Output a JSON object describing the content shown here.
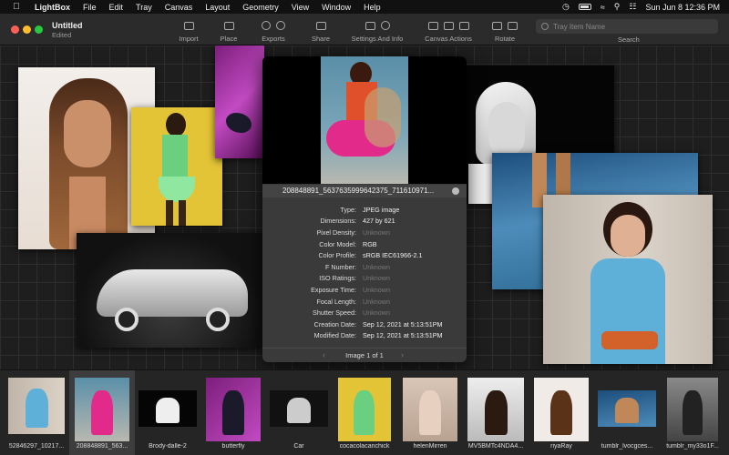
{
  "menubar": {
    "app_name": "LightBox",
    "items": [
      "File",
      "Edit",
      "Tray",
      "Canvas",
      "Layout",
      "Geometry",
      "View",
      "Window",
      "Help"
    ],
    "date_time": "Sun Jun 8  12:36 PM"
  },
  "toolbar": {
    "doc_title": "Untitled",
    "doc_subtitle": "Edited",
    "groups": [
      {
        "label": "Import"
      },
      {
        "label": "Place"
      },
      {
        "label": "Exports"
      },
      {
        "label": "Share"
      },
      {
        "label": "Settings And Info"
      },
      {
        "label": "Canvas Actions"
      },
      {
        "label": "Rotate"
      }
    ],
    "search_placeholder": "Tray Item Name",
    "search_label": "Search"
  },
  "info_popover": {
    "filename": "208848891_5637635999642375_711610971...",
    "rows": [
      {
        "key": "Type:",
        "value": "JPEG image",
        "unknown": false
      },
      {
        "key": "Dimensions:",
        "value": "427 by 621",
        "unknown": false
      },
      {
        "key": "Pixel Density:",
        "value": "Unknown",
        "unknown": true
      },
      {
        "key": "Color Model:",
        "value": "RGB",
        "unknown": false
      },
      {
        "key": "Color Profile:",
        "value": "sRGB IEC61966-2.1",
        "unknown": false
      },
      {
        "key": "F Number:",
        "value": "Unknown",
        "unknown": true
      },
      {
        "key": "ISO Ratings:",
        "value": "Unknown",
        "unknown": true
      },
      {
        "key": "Exposure Time:",
        "value": "Unknown",
        "unknown": true
      },
      {
        "key": "Focal Length:",
        "value": "Unknown",
        "unknown": true
      },
      {
        "key": "Shutter Speed:",
        "value": "Unknown",
        "unknown": true
      },
      {
        "key": "Creation Date:",
        "value": "Sep 12, 2021 at 5:13:51PM",
        "unknown": false
      },
      {
        "key": "Modified Date:",
        "value": "Sep 12, 2021 at 5:13:51PM",
        "unknown": false
      }
    ],
    "nav_label": "Image 1 of 1"
  },
  "tray": {
    "items": [
      {
        "label": "52846297_10217..."
      },
      {
        "label": "208848891_563..."
      },
      {
        "label": "Brody-dalle-2"
      },
      {
        "label": "butterfly"
      },
      {
        "label": "Car"
      },
      {
        "label": "cocacolacanchick"
      },
      {
        "label": "helenMirren"
      },
      {
        "label": "MV5BMTc4NDA4..."
      },
      {
        "label": "riyaRay"
      },
      {
        "label": "tumblr_lvocgces..."
      },
      {
        "label": "tumblr_my33o1F..."
      }
    ]
  },
  "colors": {
    "accent_close": "#ff5f57",
    "accent_min": "#febc2e",
    "accent_max": "#28c840"
  }
}
